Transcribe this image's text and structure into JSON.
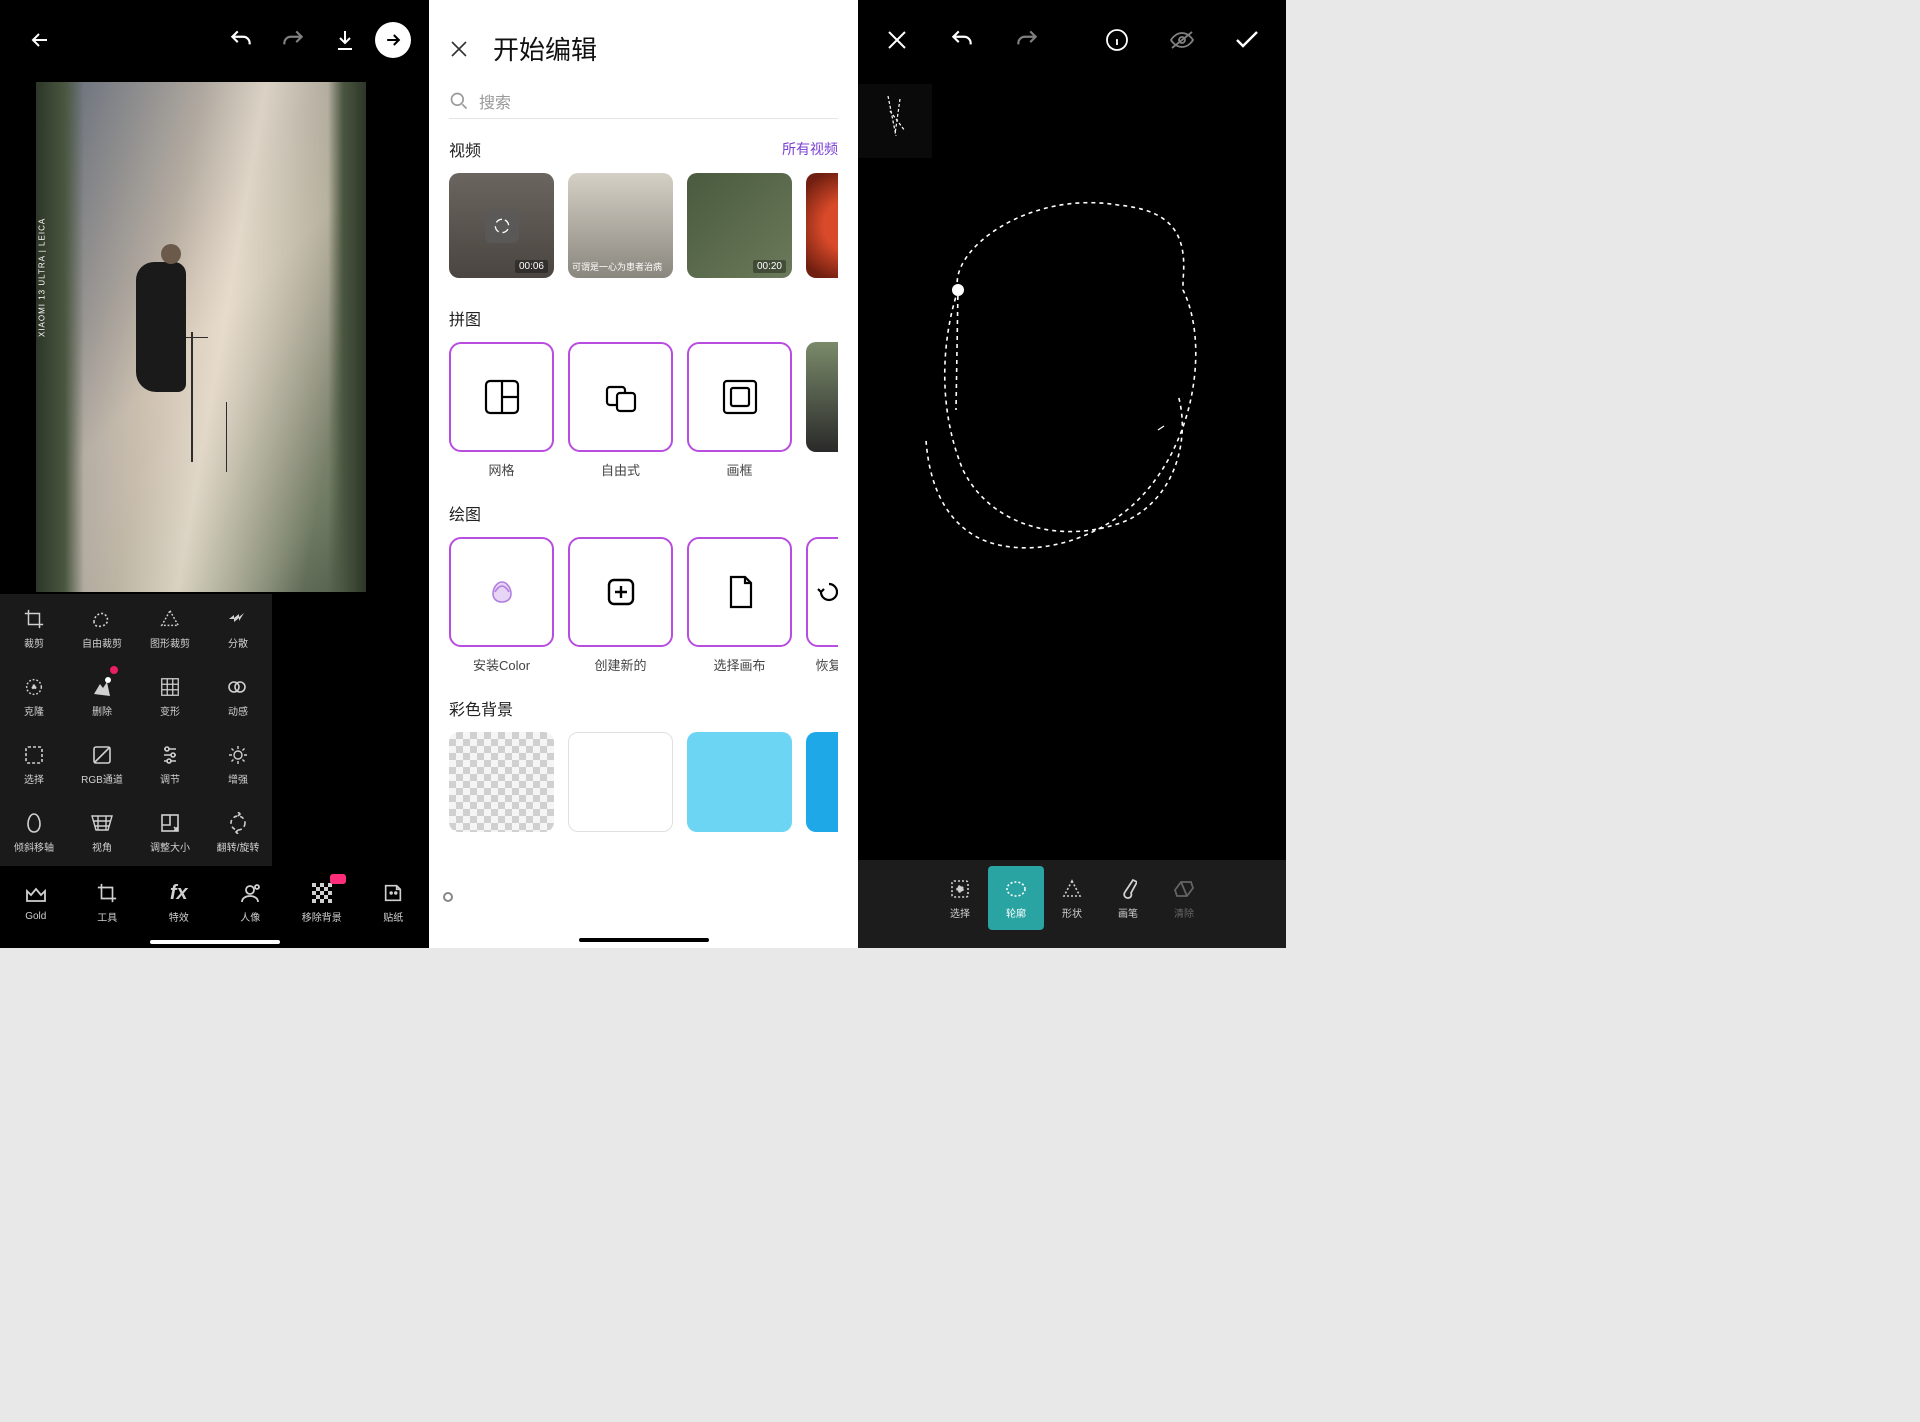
{
  "left": {
    "watermark": "XIAOMI 13 ULTRA | LEICA",
    "tools": [
      {
        "id": "crop",
        "label": "裁剪"
      },
      {
        "id": "freecrop",
        "label": "自由裁剪"
      },
      {
        "id": "shapecrop",
        "label": "图形裁剪"
      },
      {
        "id": "disperse",
        "label": "分散"
      },
      {
        "id": "clone",
        "label": "克隆"
      },
      {
        "id": "delete",
        "label": "删除",
        "badge": true
      },
      {
        "id": "distort",
        "label": "变形"
      },
      {
        "id": "motion",
        "label": "动感"
      },
      {
        "id": "select",
        "label": "选择"
      },
      {
        "id": "rgb",
        "label": "RGB通道"
      },
      {
        "id": "adjust",
        "label": "调节"
      },
      {
        "id": "enhance",
        "label": "增强"
      },
      {
        "id": "tiltshift",
        "label": "倾斜移轴"
      },
      {
        "id": "perspective",
        "label": "视角"
      },
      {
        "id": "resize",
        "label": "调整大小"
      },
      {
        "id": "rotate",
        "label": "翻转/旋转"
      }
    ],
    "bottom": [
      {
        "id": "gold",
        "label": "Gold"
      },
      {
        "id": "tools",
        "label": "工具"
      },
      {
        "id": "fx",
        "label": "特效"
      },
      {
        "id": "portrait",
        "label": "人像"
      },
      {
        "id": "removebg",
        "label": "移除背景",
        "badge": true
      },
      {
        "id": "sticker",
        "label": "贴纸"
      }
    ]
  },
  "mid": {
    "title": "开始编辑",
    "search_placeholder": "搜索",
    "sections": {
      "video": {
        "title": "视频",
        "all": "所有视频",
        "items": [
          {
            "bg": "#6b6560",
            "time": "00:06",
            "caption": ""
          },
          {
            "bg": "#bdb8b0",
            "time": "",
            "caption": "可谓是一心为患者治病"
          },
          {
            "bg": "#56614a",
            "time": "00:20",
            "caption": ""
          },
          {
            "bg": "#b5432a",
            "time": "",
            "caption": ""
          }
        ]
      },
      "collage": {
        "title": "拼图",
        "items": [
          {
            "id": "grid",
            "label": "网格"
          },
          {
            "id": "freestyle",
            "label": "自由式"
          },
          {
            "id": "frame",
            "label": "画框"
          }
        ]
      },
      "drawing": {
        "title": "绘图",
        "items": [
          {
            "id": "installcolor",
            "label": "安装Color"
          },
          {
            "id": "createnew",
            "label": "创建新的"
          },
          {
            "id": "choosecanvas",
            "label": "选择画布"
          },
          {
            "id": "restore",
            "label": "恢复"
          }
        ]
      },
      "colorbg": {
        "title": "彩色背景",
        "items": [
          {
            "type": "checker"
          },
          {
            "type": "solid",
            "color": "#ffffff",
            "border": true
          },
          {
            "type": "solid",
            "color": "#6cd5f4"
          },
          {
            "type": "solid",
            "color": "#1fa8e8"
          }
        ]
      }
    }
  },
  "right": {
    "bottom": [
      {
        "id": "select",
        "label": "选择"
      },
      {
        "id": "outline",
        "label": "轮廓",
        "active": true
      },
      {
        "id": "shape",
        "label": "形状"
      },
      {
        "id": "brush",
        "label": "画笔"
      },
      {
        "id": "erase",
        "label": "清除",
        "dim": true
      }
    ]
  }
}
